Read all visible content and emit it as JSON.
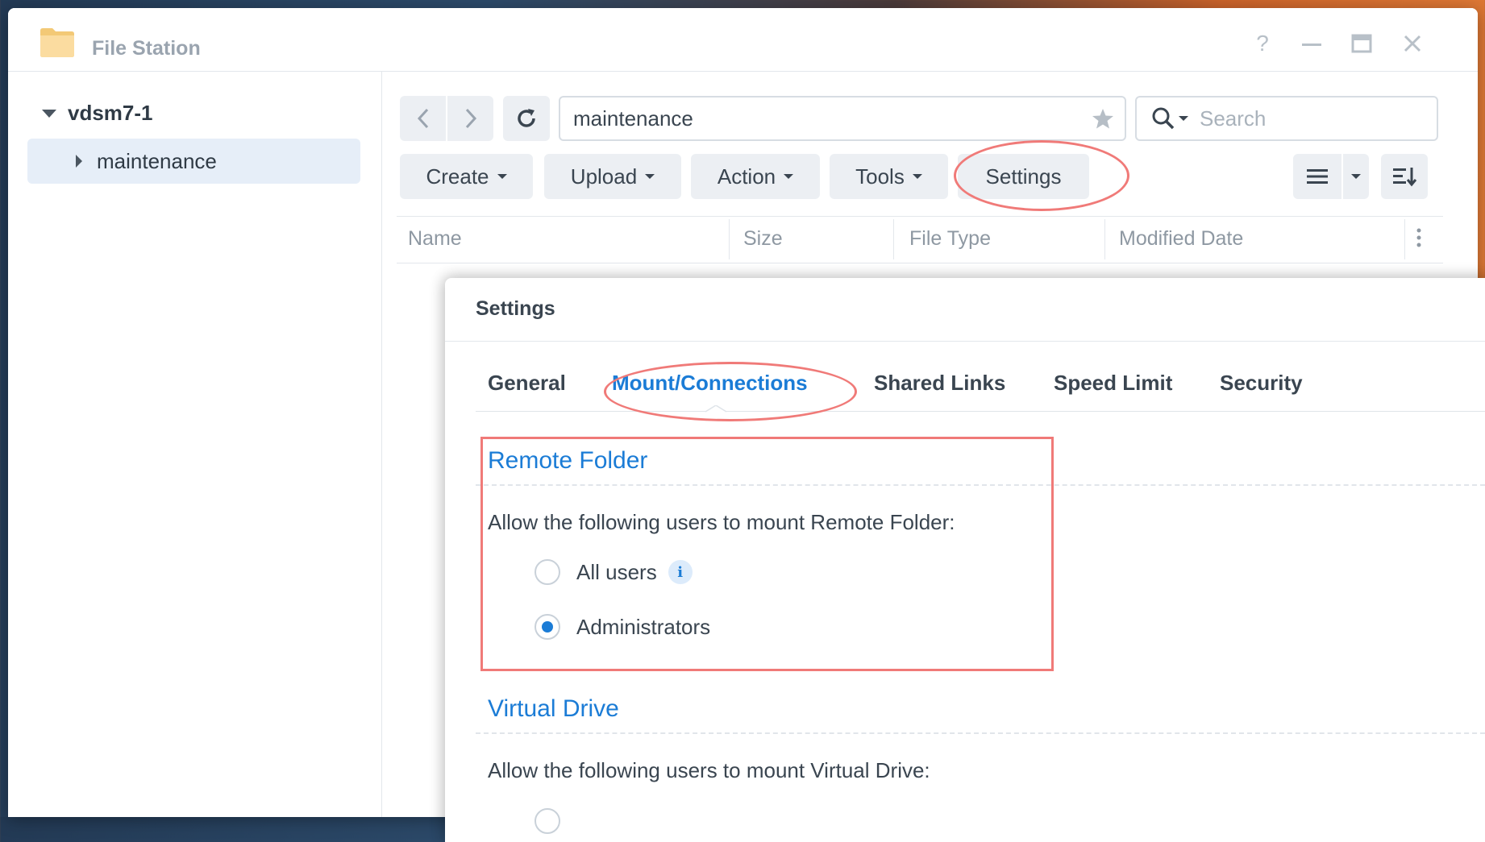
{
  "window": {
    "title": "File Station"
  },
  "sidebar": {
    "root": "vdsm7-1",
    "items": [
      {
        "label": "maintenance"
      }
    ]
  },
  "toolbar": {
    "path": "maintenance",
    "search_placeholder": "Search",
    "buttons": [
      "Create",
      "Upload",
      "Action",
      "Tools",
      "Settings"
    ]
  },
  "columns": [
    "Name",
    "Size",
    "File Type",
    "Modified Date"
  ],
  "dialog": {
    "title": "Settings",
    "tabs": [
      {
        "label": "General",
        "active": false
      },
      {
        "label": "Mount/Connections",
        "active": true
      },
      {
        "label": "Shared Links",
        "active": false
      },
      {
        "label": "Speed Limit",
        "active": false
      },
      {
        "label": "Security",
        "active": false
      }
    ],
    "remote_folder": {
      "title": "Remote Folder",
      "description": "Allow the following users to mount Remote Folder:",
      "options": [
        {
          "label": "All users",
          "selected": false
        },
        {
          "label": "Administrators",
          "selected": true
        }
      ]
    },
    "virtual_drive": {
      "title": "Virtual Drive",
      "description": "Allow the following users to mount Virtual Drive:"
    }
  },
  "colors": {
    "accent": "#1b7cd6",
    "annotation": "#f07a78"
  }
}
